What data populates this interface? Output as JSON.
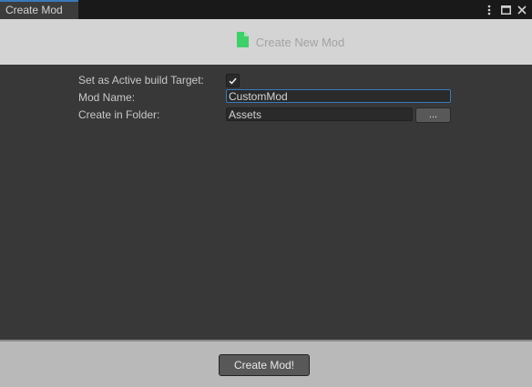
{
  "window": {
    "tab_title": "Create Mod"
  },
  "header": {
    "title": "Create New Mod",
    "icon": "file-icon",
    "icon_color": "#3fcf6b"
  },
  "form": {
    "active_build_label": "Set as Active build Target:",
    "active_build_checked": true,
    "mod_name_label": "Mod Name:",
    "mod_name_value": "CustomMod",
    "folder_label": "Create in Folder:",
    "folder_value": "Assets",
    "browse_label": "..."
  },
  "footer": {
    "create_label": "Create Mod!"
  },
  "colors": {
    "background": "#383838",
    "header_bg": "#d4d4d4",
    "focus_accent": "#3a79bb"
  }
}
